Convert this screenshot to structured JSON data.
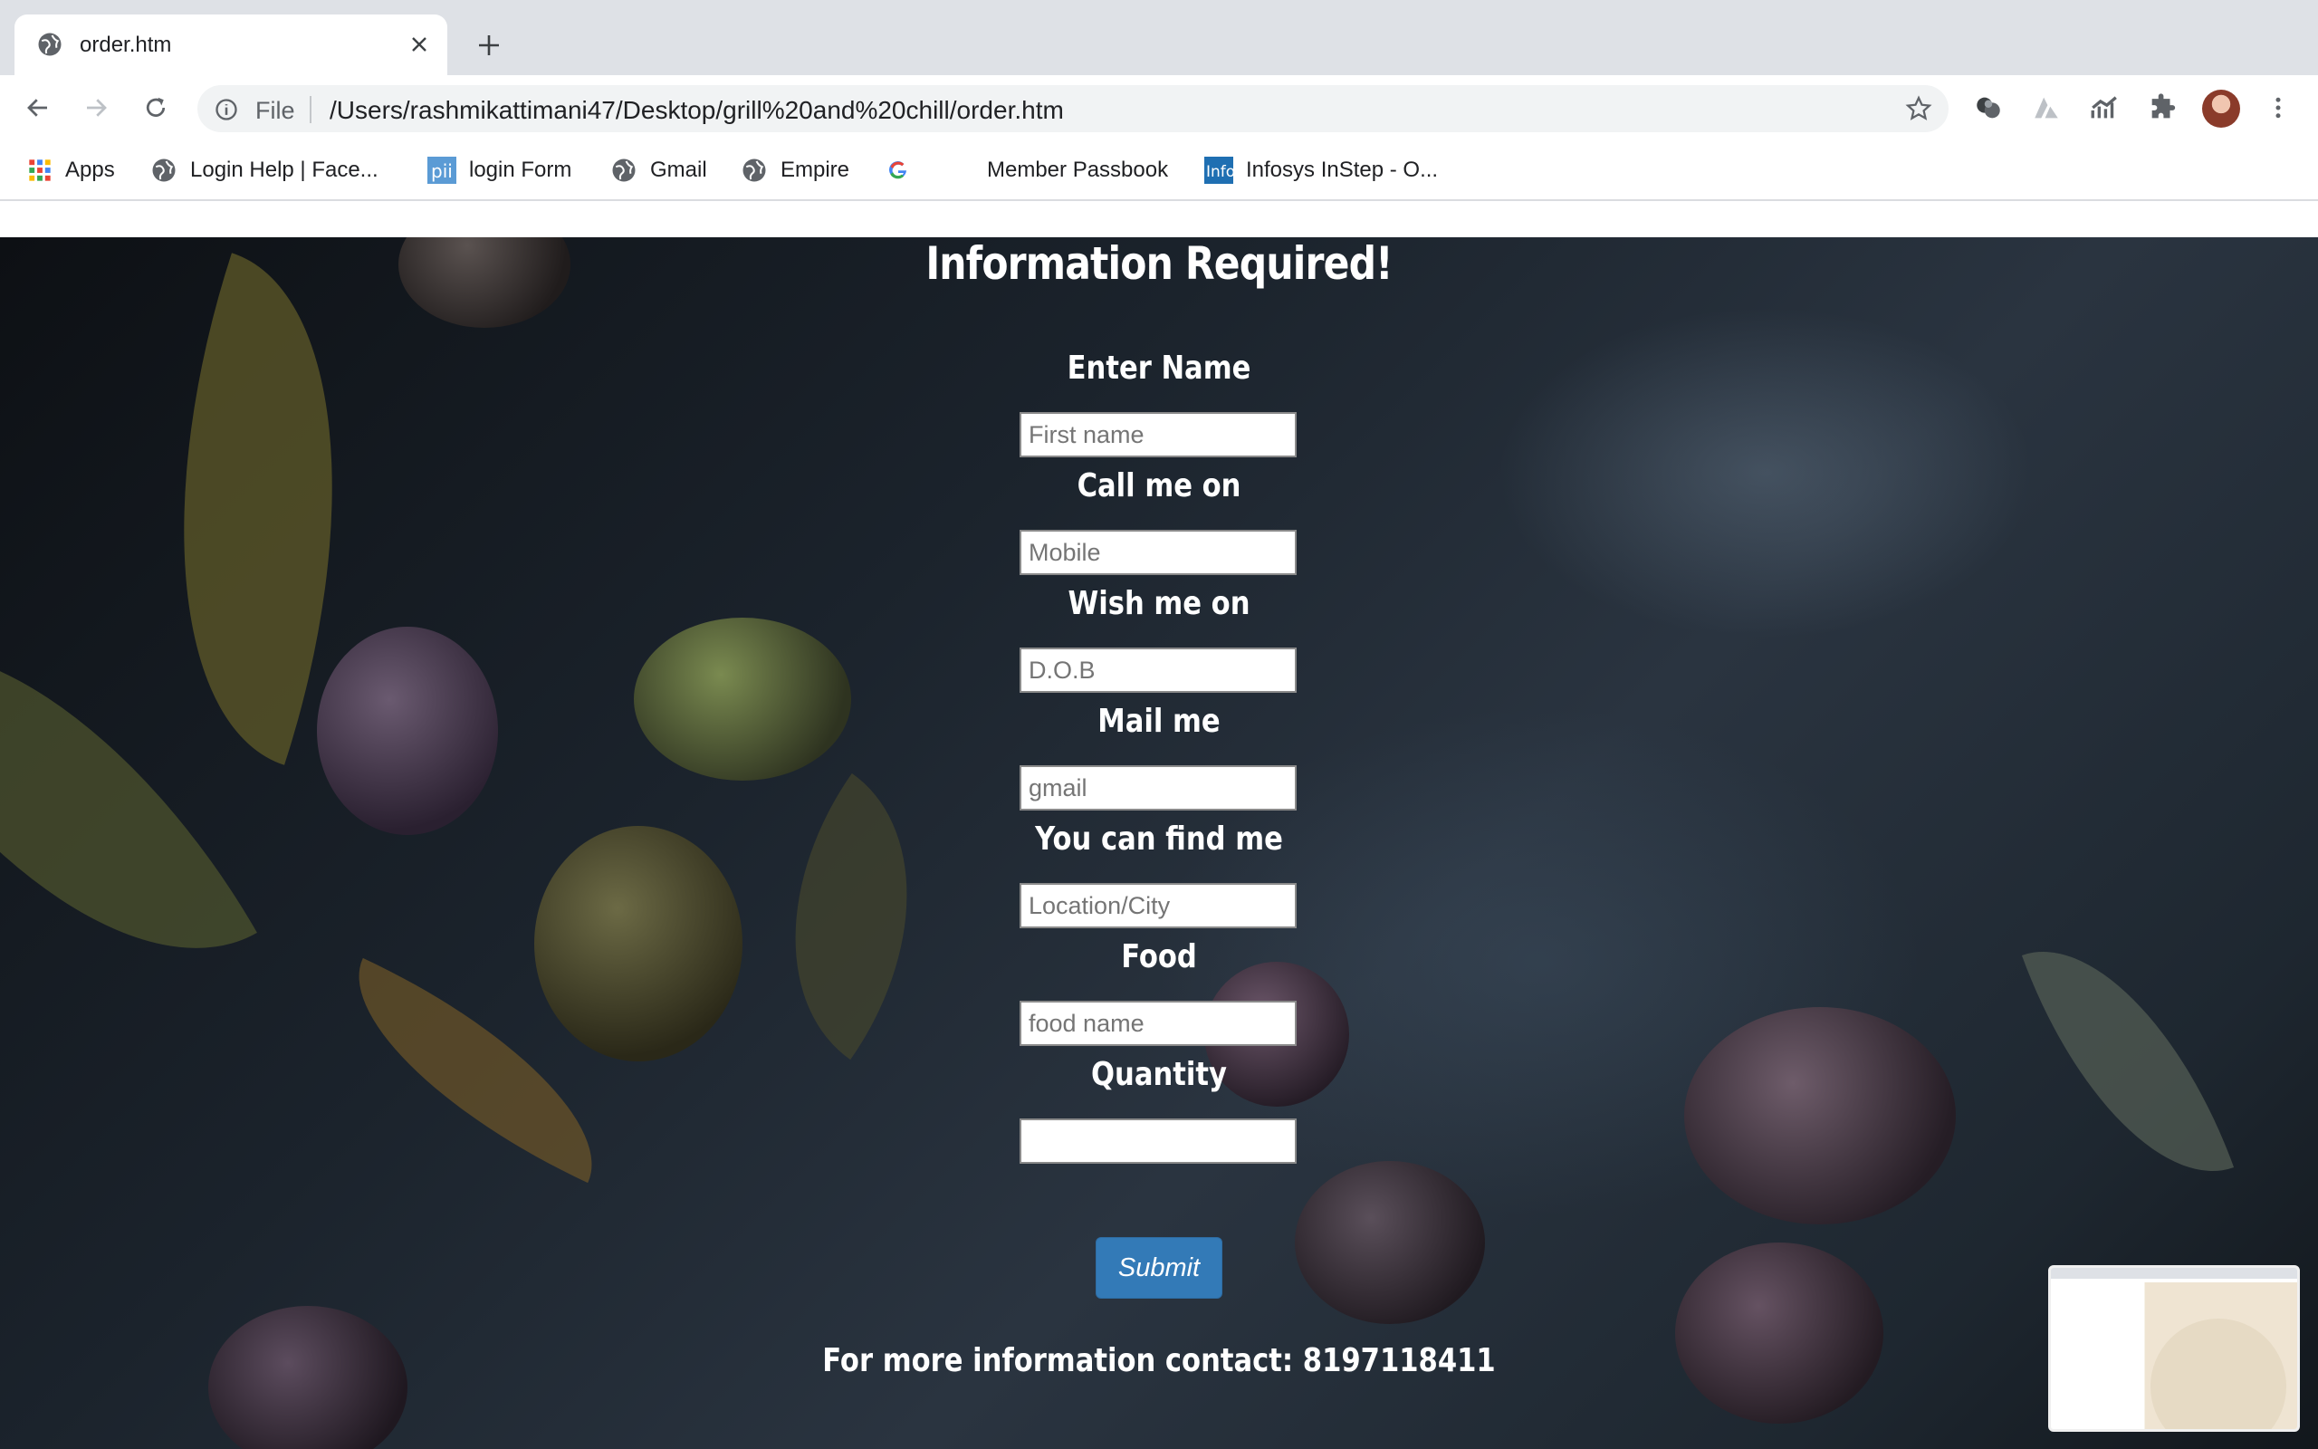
{
  "browser": {
    "tab_title": "order.htm",
    "address_scheme": "File",
    "address_url": "/Users/rashmikattimani47/Desktop/grill%20and%20chill/order.htm",
    "bookmarks": [
      {
        "label": "Apps",
        "icon": "apps-grid-icon"
      },
      {
        "label": "Login Help | Face...",
        "icon": "globe-icon"
      },
      {
        "label": "login Form",
        "icon": "pii-icon"
      },
      {
        "label": "Gmail",
        "icon": "globe-icon"
      },
      {
        "label": "Empire",
        "icon": "globe-icon"
      },
      {
        "label": "",
        "icon": "google-icon"
      },
      {
        "label": "Member Passbook",
        "icon": ""
      },
      {
        "label": "Infosys InStep - O...",
        "icon": "infosys-icon"
      }
    ]
  },
  "form": {
    "title": "Information Required!",
    "fields": [
      {
        "label": "Enter Name",
        "placeholder": "First name"
      },
      {
        "label": "Call me on",
        "placeholder": "Mobile"
      },
      {
        "label": "Wish me on",
        "placeholder": "D.O.B"
      },
      {
        "label": "Mail me",
        "placeholder": "gmail"
      },
      {
        "label": "You can find me",
        "placeholder": "Location/City"
      },
      {
        "label": "Food",
        "placeholder": "food name"
      },
      {
        "label": "Quantity",
        "placeholder": ""
      }
    ],
    "submit_label": "Submit",
    "contact": "For more information contact: 8197118411"
  }
}
